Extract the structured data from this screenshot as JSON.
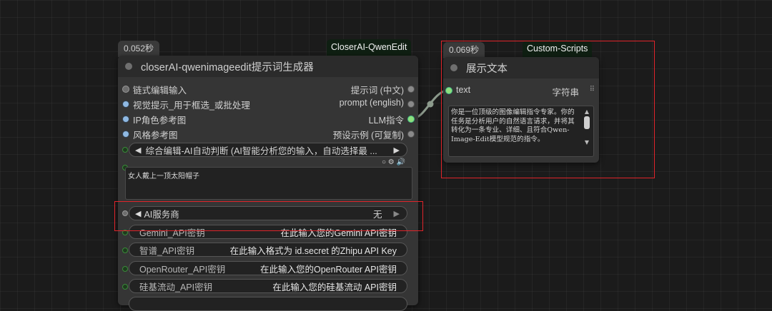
{
  "node_left": {
    "time_badge": "0.052秒",
    "group_badge": "CloserAI-QwenEdit",
    "title": "closerAI-qwenimageedit提示词生成器",
    "inputs": [
      "链式编辑输入",
      "视觉提示_用于框选_或批处理",
      "IP角色参考图",
      "风格参考图"
    ],
    "outputs": [
      "提示词 (中文)",
      "prompt (english)",
      "LLM指令",
      "预设示例 (可复制)"
    ],
    "mode_selector": "综合编辑-AI自动判断 (AI智能分析您的输入，自动选择最 ...",
    "tool_icons": "○ ⚙ 🔊",
    "prompt_text": "女人戴上一顶太阳帽子",
    "ai_service": {
      "label": "AI服务商",
      "value": "无"
    },
    "key_widgets": [
      {
        "label": "Gemini_API密钥",
        "value": "在此输入您的Gemini API密钥"
      },
      {
        "label": "智谱_API密钥",
        "value": "在此输入格式为 id.secret 的Zhipu API Key"
      },
      {
        "label": "OpenRouter_API密钥",
        "value": "在此输入您的OpenRouter API密钥"
      },
      {
        "label": "硅基流动_API密钥",
        "value": "在此输入您的硅基流动 API密钥"
      }
    ]
  },
  "node_right": {
    "time_badge": "0.069秒",
    "group_badge": "Custom-Scripts",
    "title": "展示文本",
    "input_label": "text",
    "output_label": "字符串",
    "display_text": "你是一位顶级的图像编辑指令专家。你的任务是分析用户的自然语言请求，并将其转化为一条专业、详细、且符合Qwen-Image-Edit模型规范的指令。"
  },
  "colors": {
    "canvas_bg": "#1b1b1b",
    "node_bg": "#353535",
    "highlight_red": "#e0242a",
    "link_color": "#8a9a8a",
    "socket_green": "#8ee07d",
    "socket_blue": "#8fb9e3"
  }
}
